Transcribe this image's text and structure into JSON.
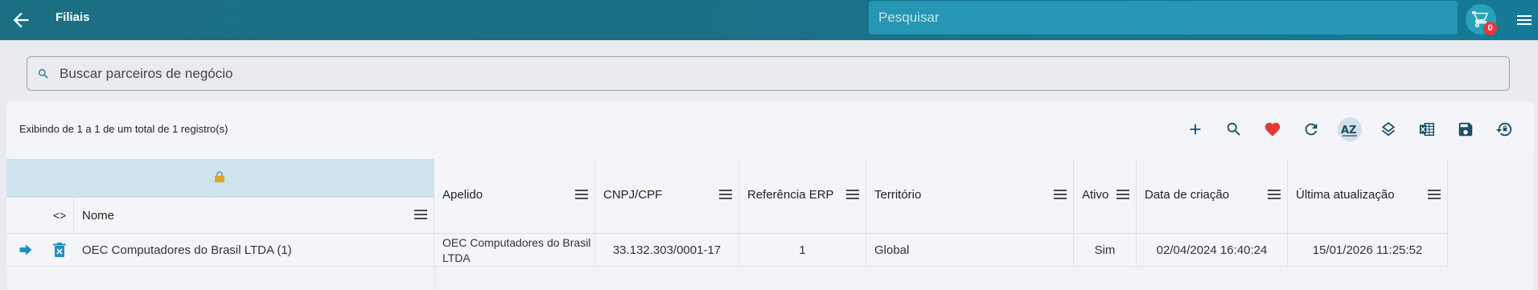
{
  "header": {
    "title": "Filiais",
    "search_placeholder": "Pesquisar",
    "cart_count": "0"
  },
  "partner_search": {
    "placeholder": "Buscar parceiros de negócio"
  },
  "toolbar": {
    "info": "Exibindo de 1 a 1 de um total de 1 registro(s)",
    "buttons": [
      "add-icon",
      "search-icon",
      "favorite-icon",
      "refresh-icon",
      "sort-az-icon",
      "layers-icon",
      "excel-icon",
      "save-icon",
      "restore-icon"
    ]
  },
  "grid": {
    "columns": {
      "code": "<>",
      "nome": "Nome",
      "apelido": "Apelido",
      "cnpj": "CNPJ/CPF",
      "referencia": "Referência ERP",
      "territorio": "Território",
      "ativo": "Ativo",
      "data_criacao": "Data de criação",
      "ultima_atualizacao": "Última atualização"
    },
    "rows": [
      {
        "nome": "OEC Computadores do Brasil LTDA (1)",
        "apelido": "OEC Computadores do Brasil LTDA",
        "cnpj": "33.132.303/0001-17",
        "referencia": "1",
        "territorio": "Global",
        "ativo": "Sim",
        "data_criacao": "02/04/2024 16:40:24",
        "ultima_atualizacao": "15/01/2026 11:25:52"
      }
    ]
  },
  "colors": {
    "topbar": "#1c6f83",
    "accent": "#2aa0bd",
    "favorite": "#e53935",
    "action": "#1f8fc4"
  }
}
